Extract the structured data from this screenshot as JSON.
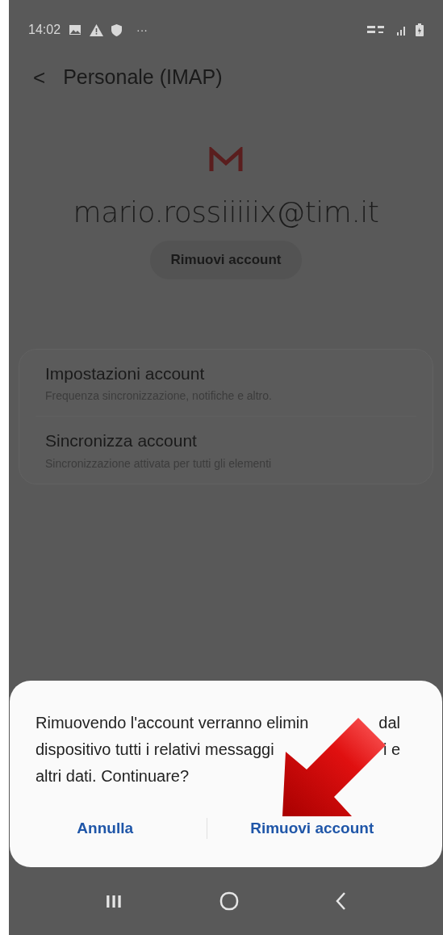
{
  "status_bar": {
    "time": "14:02",
    "overflow": "···"
  },
  "header": {
    "back": "<",
    "title": "Personale (IMAP)"
  },
  "account": {
    "email": "mario.rossiiiiix@tim.it",
    "remove_button": "Rimuovi account"
  },
  "settings": [
    {
      "title": "Impostazioni account",
      "subtitle": "Frequenza sincronizzazione, notifiche e altro."
    },
    {
      "title": "Sincronizza account",
      "subtitle": "Sincronizzazione attivata per tutti gli elementi"
    }
  ],
  "dialog": {
    "message_lines": [
      [
        "Rimuovendo l'account verranno elimin",
        "dal"
      ],
      [
        "dispositivo tutti i relativi messaggi",
        "i e"
      ],
      [
        "altri dati. Continuare?"
      ]
    ],
    "buttons": [
      {
        "label": "Annulla"
      },
      {
        "label": "Rimuovi account"
      }
    ]
  },
  "nav_bar": {
    "recents": "III"
  }
}
